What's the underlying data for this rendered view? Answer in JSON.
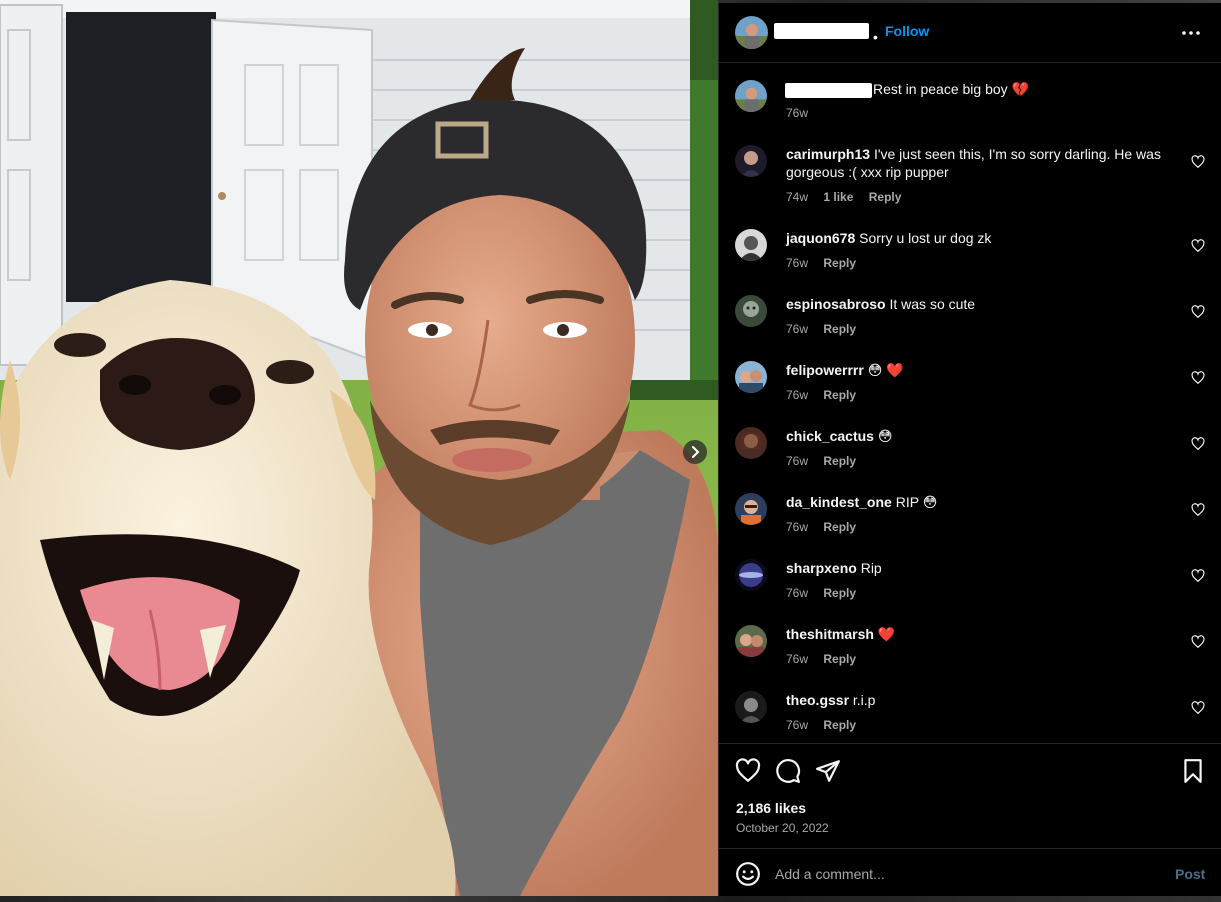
{
  "header": {
    "follow_label": "Follow",
    "separator": "•"
  },
  "caption": {
    "text": "Rest in peace big boy 💔",
    "time": "76w"
  },
  "comments": [
    {
      "user": "carimurph13",
      "text": "I've just seen this, I'm so sorry darling. He was gorgeous :( xxx rip pupper",
      "time": "74w",
      "likes": "1 like",
      "reply": "Reply"
    },
    {
      "user": "jaquon678",
      "text": "Sorry u lost ur dog zk",
      "time": "76w",
      "reply": "Reply"
    },
    {
      "user": "espinosabroso",
      "text": "It was so cute",
      "time": "76w",
      "reply": "Reply"
    },
    {
      "user": "felipowerrrr",
      "text": "😳 ❤️",
      "time": "76w",
      "reply": "Reply"
    },
    {
      "user": "chick_cactus",
      "text": "😳",
      "time": "76w",
      "reply": "Reply"
    },
    {
      "user": "da_kindest_one",
      "text": "RIP 😳",
      "time": "76w",
      "reply": "Reply"
    },
    {
      "user": "sharpxeno",
      "text": "Rip",
      "time": "76w",
      "reply": "Reply"
    },
    {
      "user": "theshitmarsh",
      "text": "❤️",
      "time": "76w",
      "reply": "Reply"
    },
    {
      "user": "theo.gssr",
      "text": "r.i.p",
      "time": "76w",
      "reply": "Reply"
    }
  ],
  "footer": {
    "likes": "2,186 likes",
    "date": "October 20, 2022",
    "comment_placeholder": "Add a comment...",
    "post_label": "Post"
  },
  "icons": {
    "like": "heart-icon",
    "comment": "comment-bubble-icon",
    "share": "paper-plane-icon",
    "save": "bookmark-icon",
    "more": "more-options-icon",
    "emoji": "emoji-icon",
    "next": "chevron-right-icon"
  },
  "colors": {
    "background": "#000000",
    "accent": "#0095f6",
    "muted_text": "#a8a8a8",
    "divider": "#262626",
    "heart": "#ff3040"
  }
}
